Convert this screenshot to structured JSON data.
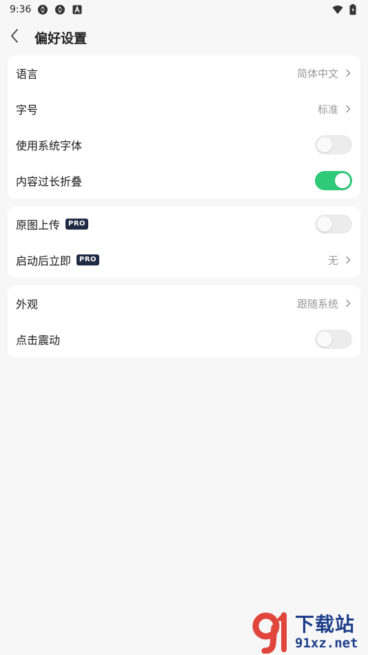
{
  "status_bar": {
    "time": "9:36",
    "left_icons": [
      "settings-sync-icon",
      "settings-sync-icon",
      "text-a-icon"
    ],
    "right_icons": [
      "wifi-icon",
      "battery-icon"
    ]
  },
  "header": {
    "back_icon": "chevron-left-icon",
    "title": "偏好设置"
  },
  "sections": [
    {
      "rows": [
        {
          "label": "语言",
          "value": "简体中文",
          "kind": "nav"
        },
        {
          "label": "字号",
          "value": "标准",
          "kind": "nav"
        },
        {
          "label": "使用系统字体",
          "kind": "toggle",
          "on": false
        },
        {
          "label": "内容过长折叠",
          "kind": "toggle",
          "on": true
        }
      ]
    },
    {
      "rows": [
        {
          "label": "原图上传",
          "badge": "PRO",
          "kind": "toggle",
          "on": false
        },
        {
          "label": "启动后立即",
          "badge": "PRO",
          "value": "无",
          "kind": "nav"
        }
      ]
    },
    {
      "rows": [
        {
          "label": "外观",
          "value": "跟随系统",
          "kind": "nav"
        },
        {
          "label": "点击震动",
          "kind": "toggle",
          "on": false
        }
      ]
    }
  ],
  "watermark": {
    "cn": "下载站",
    "url": "91xz.net"
  },
  "colors": {
    "background": "#f7f7f7",
    "card": "#ffffff",
    "toggle_on": "#2fc97a",
    "toggle_off": "#ececec",
    "value_text": "#999999",
    "pro_badge": "#1f2a44"
  }
}
